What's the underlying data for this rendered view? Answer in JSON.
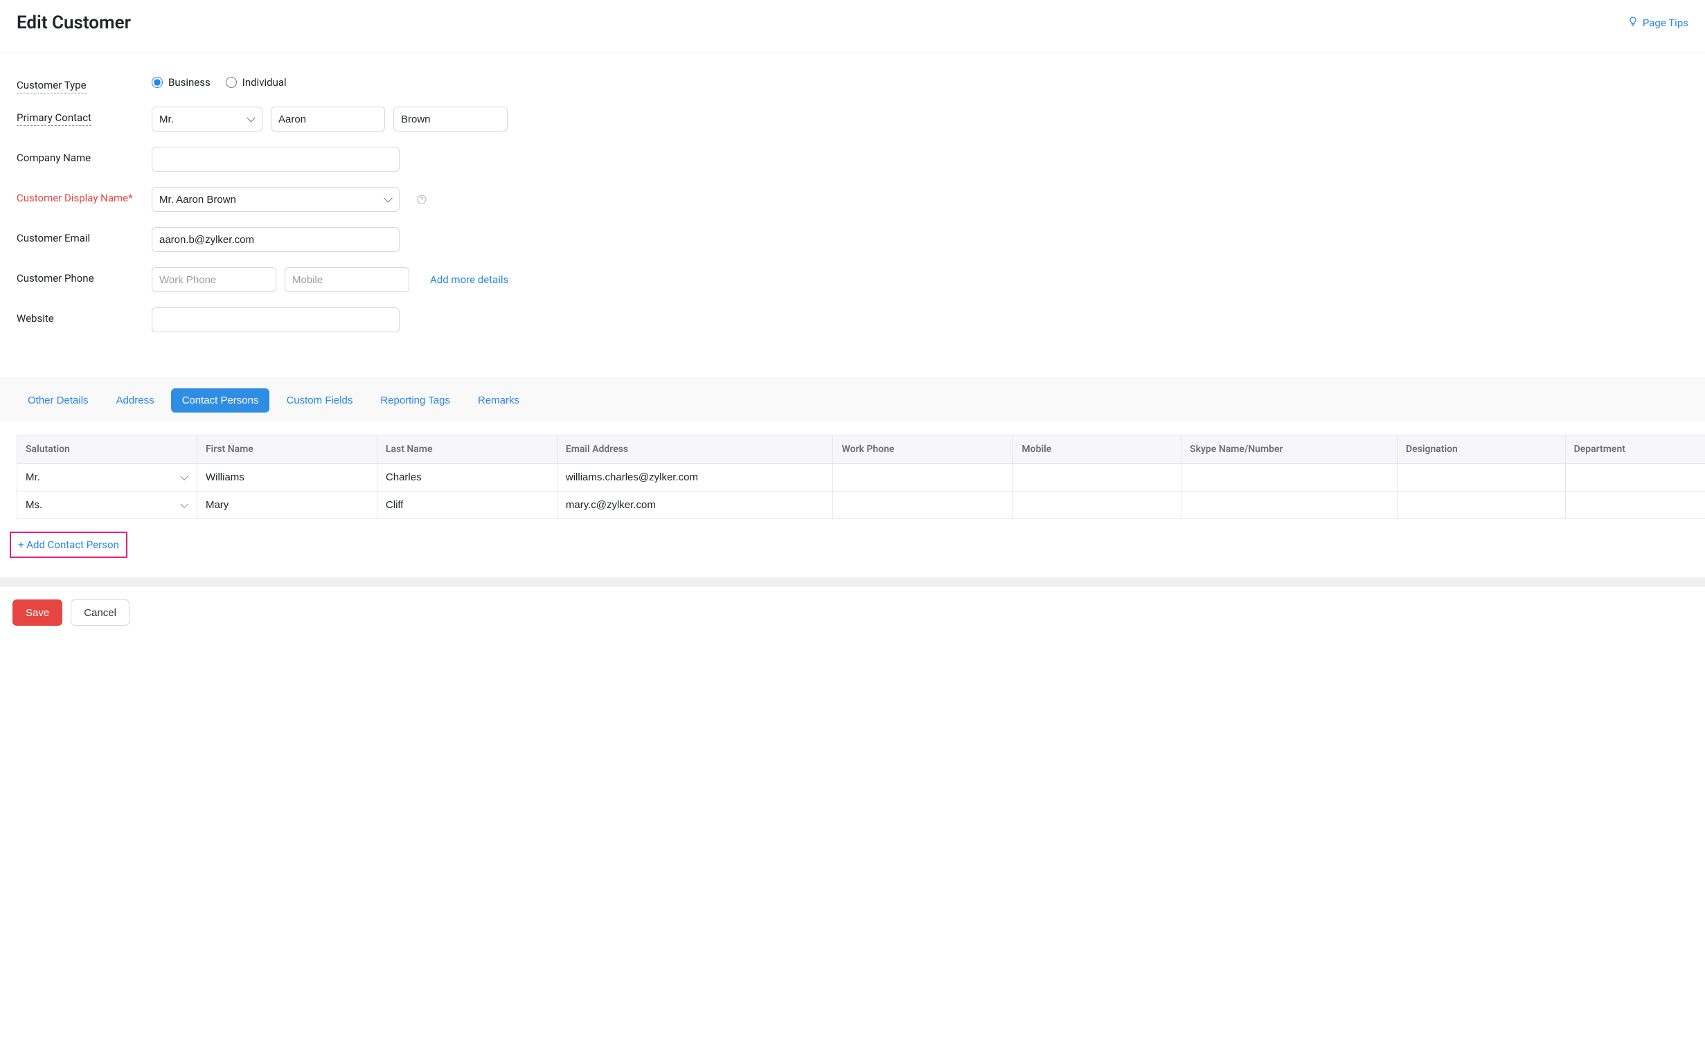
{
  "header": {
    "title": "Edit Customer",
    "page_tips": "Page Tips"
  },
  "form": {
    "customer_type": {
      "label": "Customer Type",
      "options": {
        "business": "Business",
        "individual": "Individual"
      },
      "selected": "business"
    },
    "primary_contact": {
      "label": "Primary Contact",
      "salutation": "Mr.",
      "first_name": "Aaron",
      "last_name": "Brown"
    },
    "company_name": {
      "label": "Company Name",
      "value": ""
    },
    "display_name": {
      "label": "Customer Display Name*",
      "value": "Mr. Aaron Brown"
    },
    "email": {
      "label": "Customer Email",
      "value": "aaron.b@zylker.com"
    },
    "phone": {
      "label": "Customer Phone",
      "work_placeholder": "Work Phone",
      "mobile_placeholder": "Mobile",
      "work_value": "",
      "mobile_value": "",
      "add_more_label": "Add more details"
    },
    "website": {
      "label": "Website",
      "value": ""
    }
  },
  "tabs": {
    "items": [
      {
        "id": "other",
        "label": "Other Details",
        "active": false
      },
      {
        "id": "address",
        "label": "Address",
        "active": false
      },
      {
        "id": "contact",
        "label": "Contact Persons",
        "active": true
      },
      {
        "id": "custom",
        "label": "Custom Fields",
        "active": false
      },
      {
        "id": "tags",
        "label": "Reporting Tags",
        "active": false
      },
      {
        "id": "remarks",
        "label": "Remarks",
        "active": false
      }
    ]
  },
  "contact_persons": {
    "headers": {
      "salutation": "Salutation",
      "first_name": "First Name",
      "last_name": "Last Name",
      "email": "Email Address",
      "work_phone": "Work Phone",
      "mobile": "Mobile",
      "skype": "Skype Name/Number",
      "designation": "Designation",
      "department": "Department"
    },
    "rows": [
      {
        "salutation": "Mr.",
        "first_name": "Williams",
        "last_name": "Charles",
        "email": "williams.charles@zylker.com",
        "work_phone": "",
        "mobile": "",
        "skype": "",
        "designation": "",
        "department": ""
      },
      {
        "salutation": "Ms.",
        "first_name": "Mary",
        "last_name": "Cliff",
        "email": "mary.c@zylker.com",
        "work_phone": "",
        "mobile": "",
        "skype": "",
        "designation": "",
        "department": ""
      }
    ],
    "add_label": "+ Add Contact Person"
  },
  "footer": {
    "save": "Save",
    "cancel": "Cancel"
  }
}
